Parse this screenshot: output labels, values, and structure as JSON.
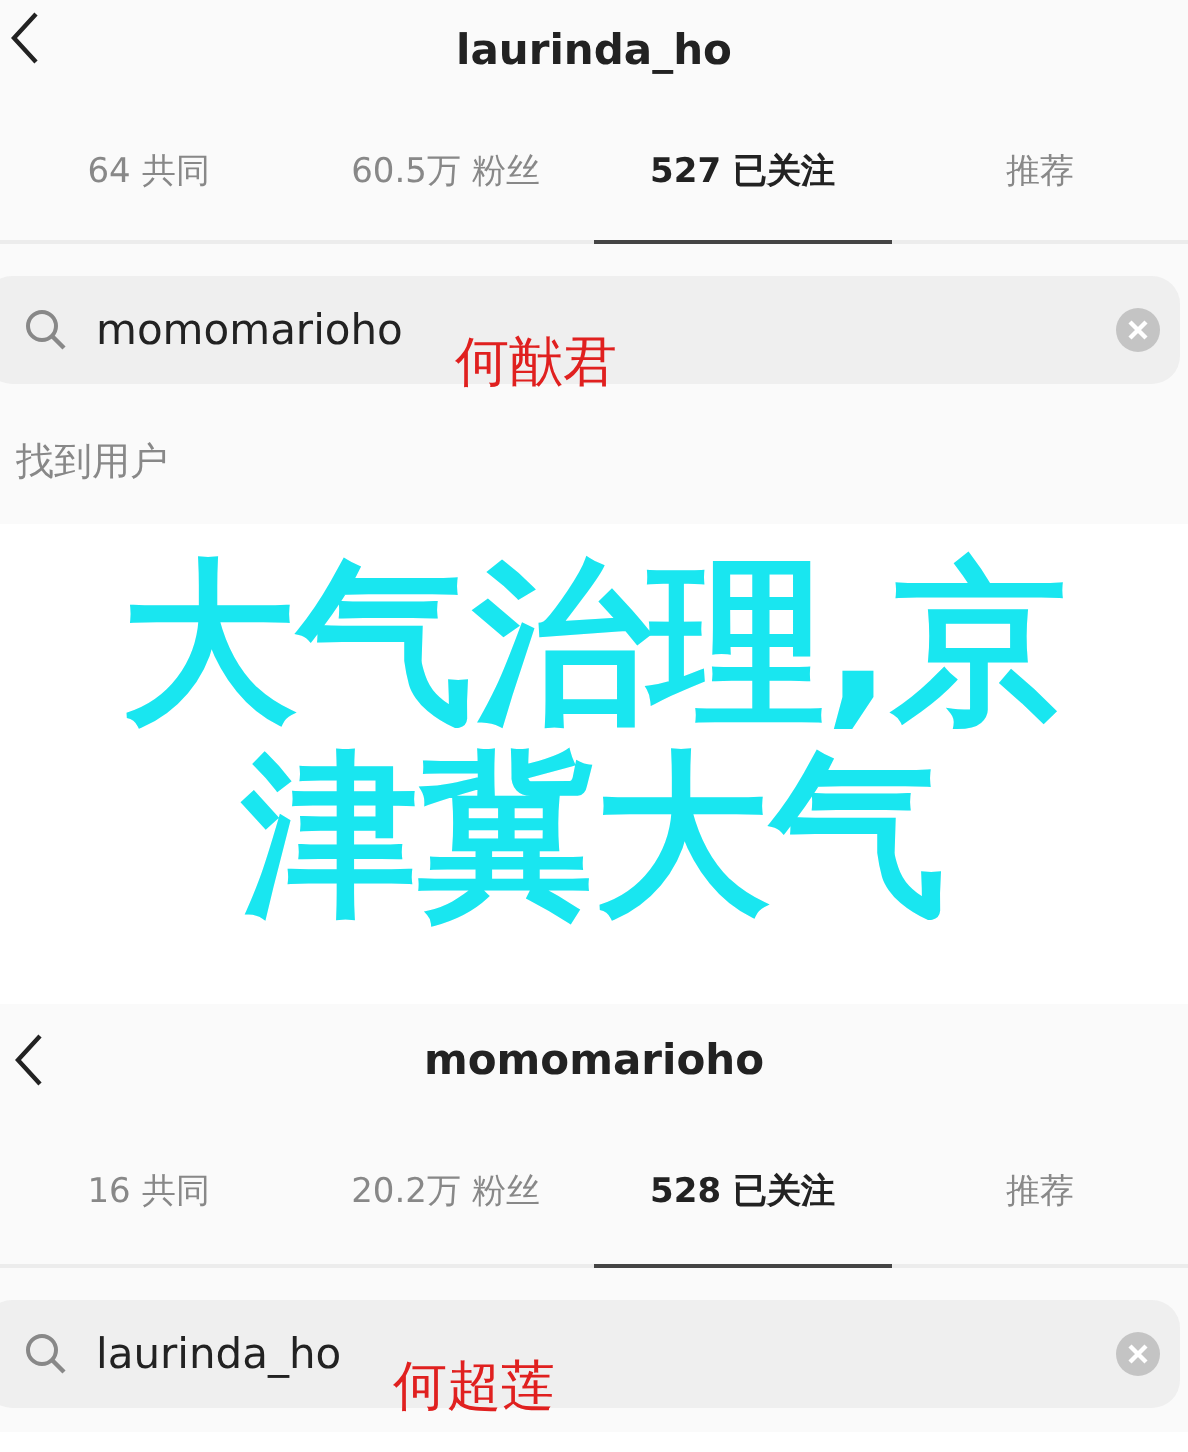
{
  "panels": [
    {
      "title": "laurinda_ho",
      "tabs": [
        {
          "label": "64 共同",
          "selected": false
        },
        {
          "label": "60.5万 粉丝",
          "selected": false
        },
        {
          "label": "527 已关注",
          "selected": true
        },
        {
          "label": "推荐",
          "selected": false
        }
      ],
      "search": {
        "value": "momomarioho"
      },
      "annotation": "何猷君",
      "message": "找到用户"
    },
    {
      "title": "momomarioho",
      "tabs": [
        {
          "label": "16 共同",
          "selected": false
        },
        {
          "label": "20.2万 粉丝",
          "selected": false
        },
        {
          "label": "528 已关注",
          "selected": true
        },
        {
          "label": "推荐",
          "selected": false
        }
      ],
      "search": {
        "value": "laurinda_ho"
      },
      "annotation": "何超莲"
    }
  ],
  "caption": [
    "大气治理,京",
    "津冀大气"
  ]
}
